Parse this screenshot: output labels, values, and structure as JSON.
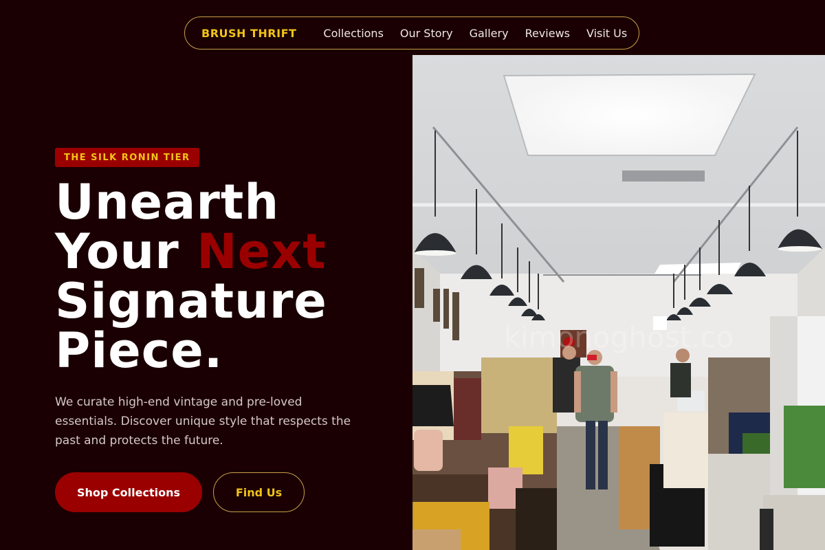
{
  "nav": {
    "brand": "BRUSH THRIFT",
    "links": [
      "Collections",
      "Our Story",
      "Gallery",
      "Reviews",
      "Visit Us"
    ]
  },
  "hero": {
    "badge": "THE SILK RONIN TIER",
    "headline_line1": "Unearth",
    "headline_line2_start": "Your ",
    "headline_accent": "Next",
    "headline_line3": "Signature",
    "headline_line4": "Piece.",
    "description": "We curate high-end vintage and pre-loved essentials. Discover unique style that respects the past and protects the future.",
    "primary_button": "Shop Collections",
    "secondary_button": "Find Us"
  },
  "photo": {
    "watermark": "kimonoghost.co"
  },
  "colors": {
    "background": "#1a0003",
    "accent_red": "#9b0000",
    "accent_gold": "#f2c418",
    "border_gold": "#c9a14a"
  }
}
